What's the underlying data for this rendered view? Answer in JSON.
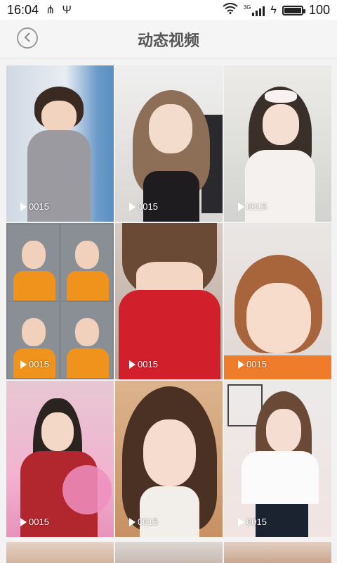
{
  "status_bar": {
    "time": "16:04",
    "left_icons": [
      "usb-tether-icon",
      "usb-debug-icon"
    ],
    "right_icons": [
      "wifi-icon",
      "signal-3g-icon",
      "charging-icon",
      "battery-icon"
    ],
    "network_label": "3G",
    "battery_level": 100,
    "battery_text": "100"
  },
  "header": {
    "back_icon": "chevron-left-icon",
    "title": "动态视频"
  },
  "videos": [
    {
      "duration": "0015"
    },
    {
      "duration": "0015"
    },
    {
      "duration": "0015"
    },
    {
      "duration": "0015"
    },
    {
      "duration": "0015"
    },
    {
      "duration": "0015"
    },
    {
      "duration": "0015"
    },
    {
      "duration": "0015"
    },
    {
      "duration": "0015"
    }
  ],
  "colors": {
    "header_bg": "#f5f5f5",
    "title_text": "#555555",
    "page_bg": "#f3f3f3"
  }
}
